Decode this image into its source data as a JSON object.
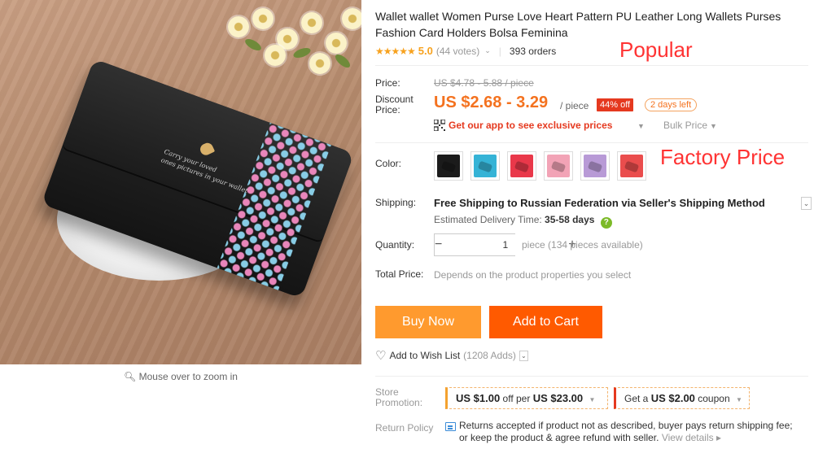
{
  "product": {
    "title": "Wallet wallet Women Purse Love Heart Pattern PU Leather Long Wallets Purses Fashion Card Holders Bolsa Feminina",
    "rating_stars": "★★★★★",
    "rating_score": "5.0",
    "rating_votes": "(44 votes)",
    "orders": "393 orders",
    "image_wallet_text": "Carry your loved\nones pictures in your wallet"
  },
  "annotations": {
    "popular": "Popular",
    "factory_price": "Factory Price"
  },
  "gallery": {
    "zoom_hint": "Mouse over to zoom in"
  },
  "price": {
    "label": "Price:",
    "original": "US $4.78 - 5.88 / piece",
    "discount_label": "Discount Price:",
    "current": "US $2.68 - 3.29",
    "unit": "/ piece",
    "discount_badge": "44% off",
    "time_left": "2 days left",
    "app_offer": "Get our app to see exclusive prices",
    "bulk_price": "Bulk Price"
  },
  "options": {
    "color_label": "Color:",
    "swatches": [
      {
        "name": "black",
        "color": "#1b1b1b"
      },
      {
        "name": "blue",
        "color": "#35b3d6"
      },
      {
        "name": "red",
        "color": "#e9384a"
      },
      {
        "name": "pink",
        "color": "#f2a3b6"
      },
      {
        "name": "purple",
        "color": "#b89ad6"
      },
      {
        "name": "watermelon",
        "color": "#ea4d4d"
      }
    ]
  },
  "shipping": {
    "label": "Shipping:",
    "method": "Free Shipping to Russian Federation via Seller's Shipping Method",
    "estimate_label": "Estimated Delivery Time:",
    "estimate_value": "35-58 days"
  },
  "quantity": {
    "label": "Quantity:",
    "value": "1",
    "minus": "−",
    "plus": "+",
    "note": "piece (134 pieces available)"
  },
  "total": {
    "label": "Total Price:",
    "value": "Depends on the product properties you select"
  },
  "actions": {
    "buy_now": "Buy Now",
    "add_to_cart": "Add to Cart",
    "wishlist": "Add to Wish List",
    "wishlist_count": "(1208 Adds)"
  },
  "promotion": {
    "label": "Store Promotion:",
    "coupon1_prefix": "US $1.00",
    "coupon1_mid": "off per",
    "coupon1_amount": "US $23.00",
    "coupon2_prefix": "Get a",
    "coupon2_amount": "US $2.00",
    "coupon2_suffix": "coupon"
  },
  "return_policy": {
    "label": "Return Policy",
    "text": "Returns accepted if product not as described, buyer pays return shipping fee; or keep the product & agree refund with seller.",
    "link": "View details"
  },
  "colors": {
    "accent_orange": "#f4721f",
    "buy_now_bg": "#ff9a2e",
    "add_to_cart_bg": "#ff5a00",
    "badge_red": "#e5391f",
    "annotation_red": "#ff3333"
  }
}
